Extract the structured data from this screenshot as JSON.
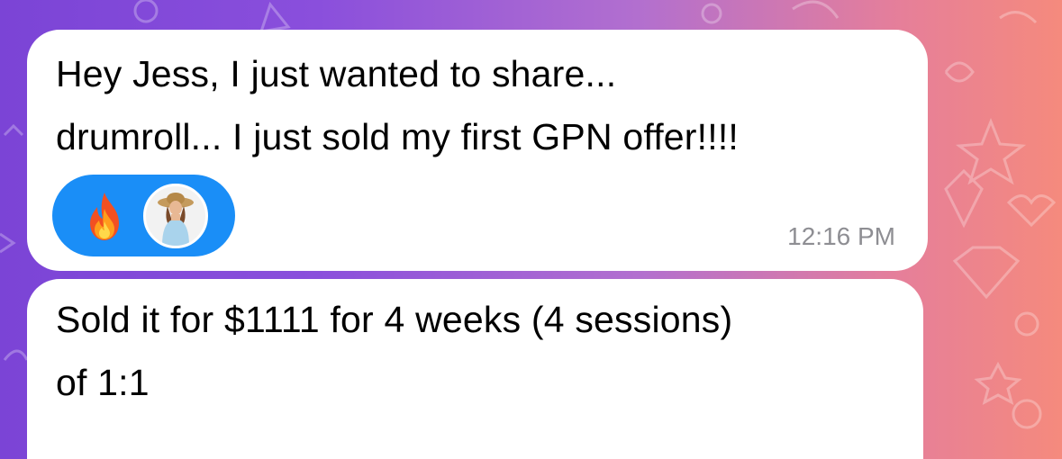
{
  "messages": [
    {
      "text": "Hey Jess, I just wanted to share...\ndrumroll... I just sold my first GPN offer!!!!",
      "time": "12:16 PM",
      "reaction": {
        "icon": "fire-icon",
        "avatar": "avatar",
        "color": "#1a8ef7"
      }
    },
    {
      "text": "Sold it for $1111 for 4 weeks (4 sessions)\nof 1:1"
    }
  ],
  "colors": {
    "background_start": "#7b44d6",
    "background_end": "#f58a7d",
    "bubble": "#ffffff",
    "timestamp": "#8e8e93"
  }
}
